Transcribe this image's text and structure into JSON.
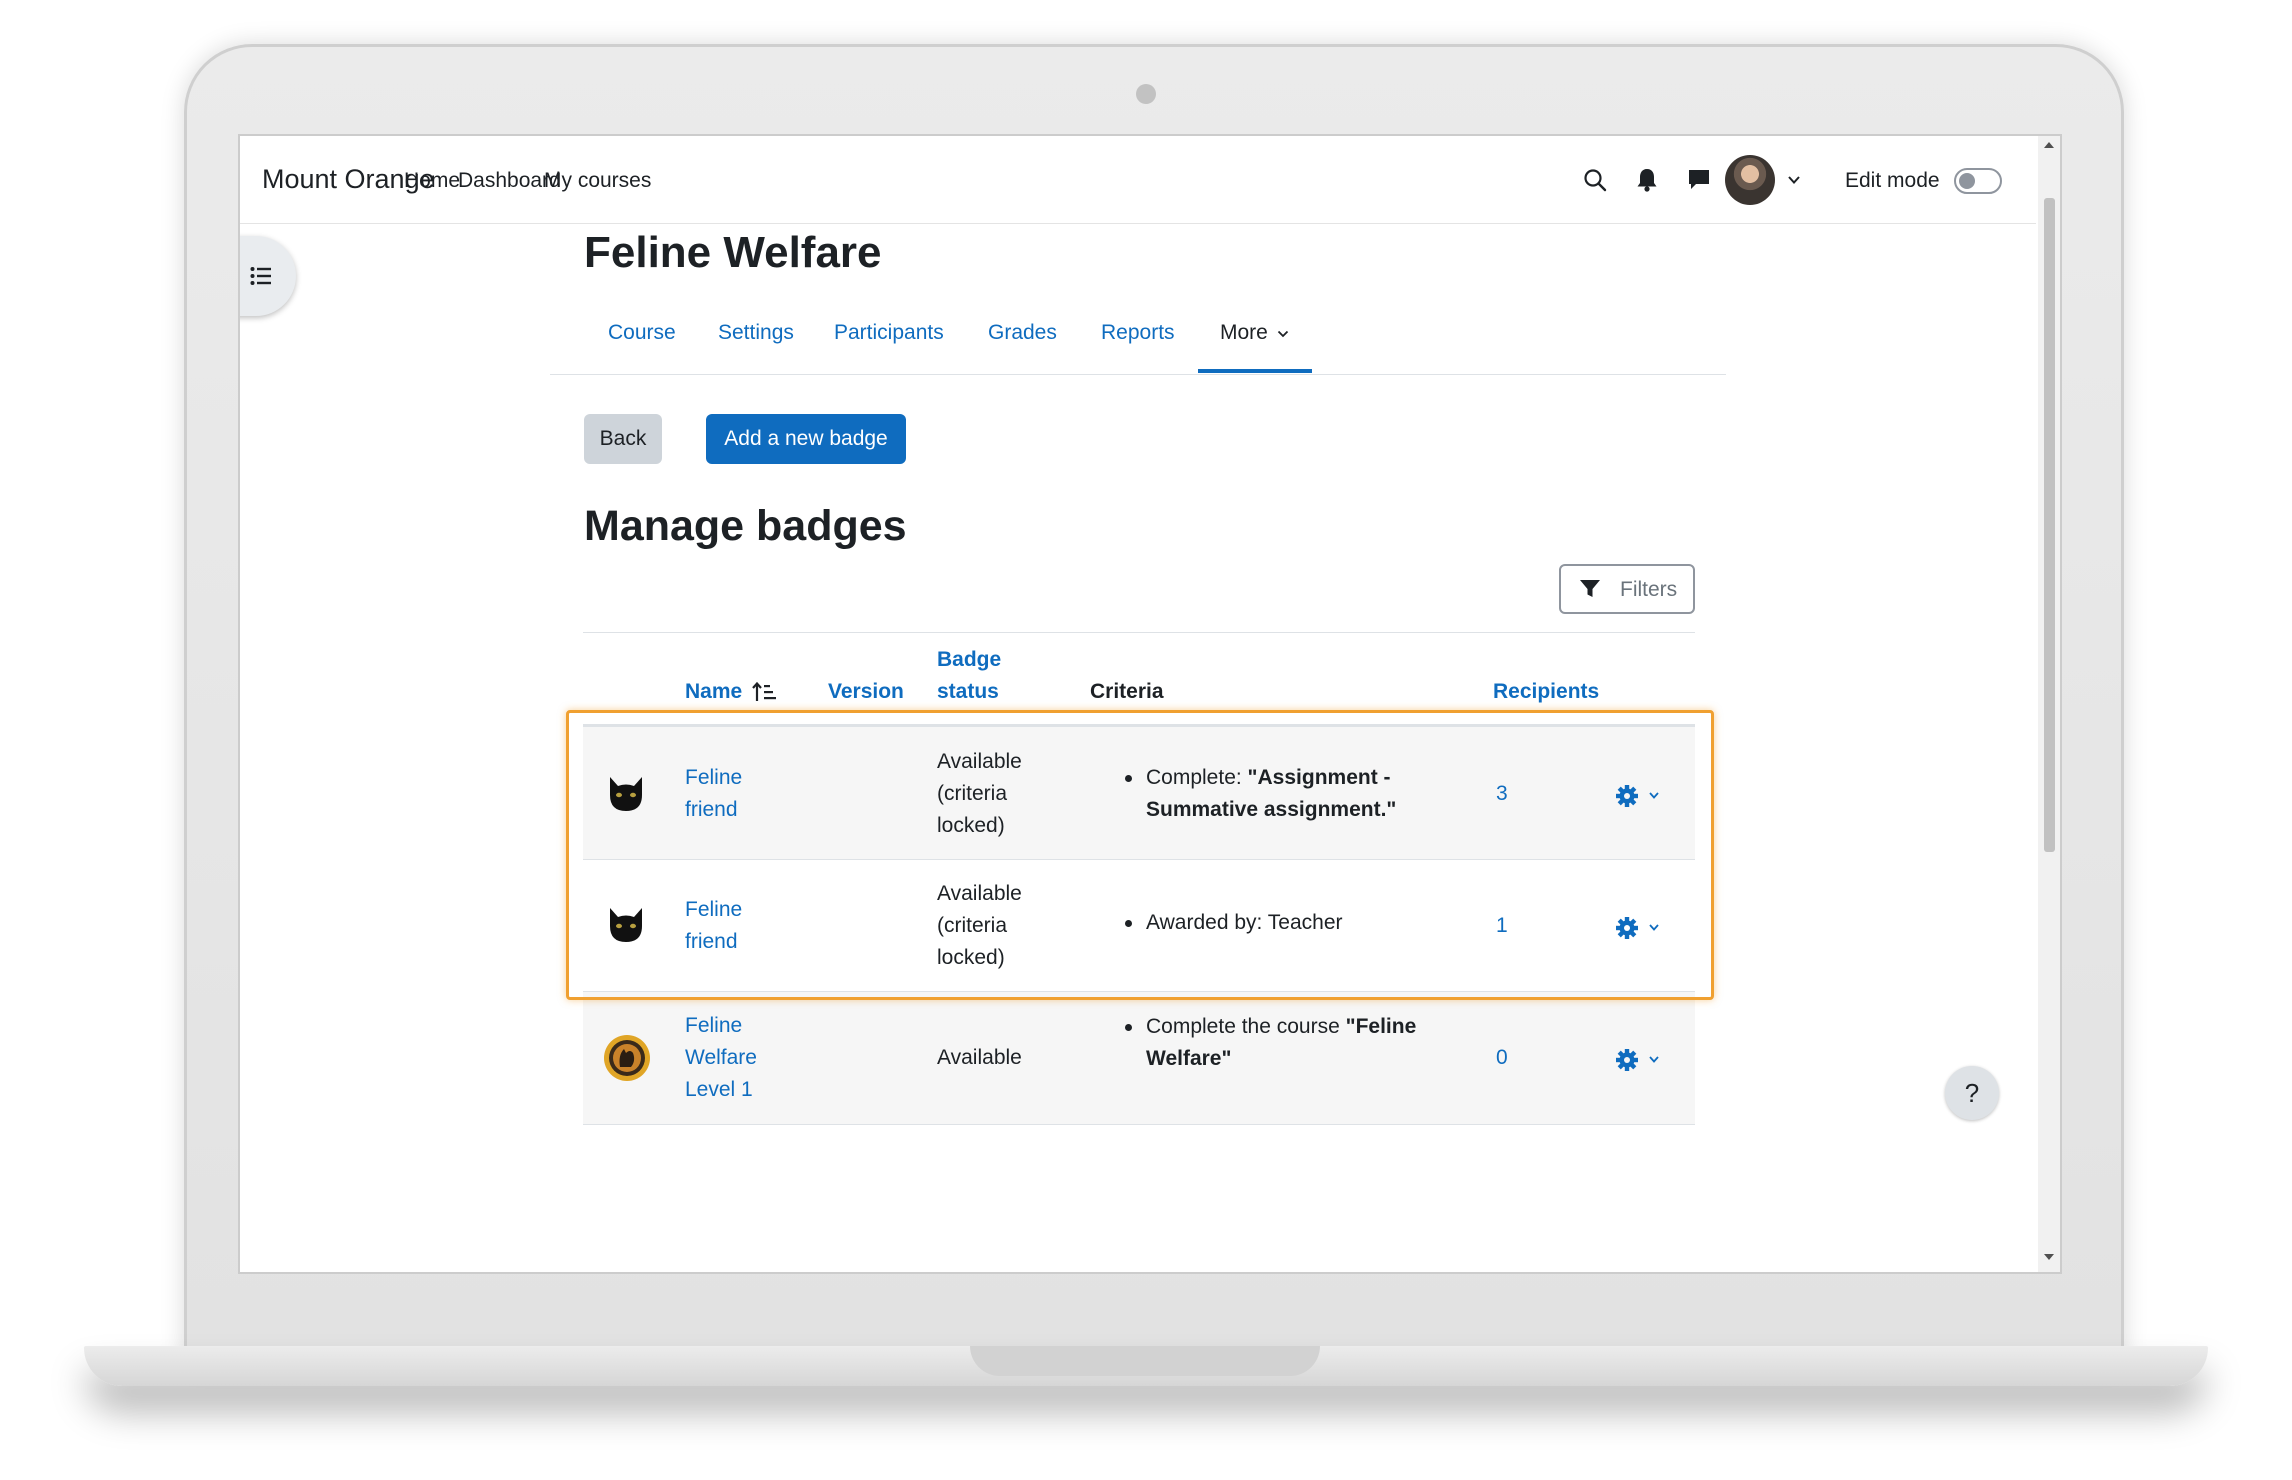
{
  "navbar": {
    "site_name": "Mount Orange",
    "links": [
      "Home",
      "Dashboard",
      "My courses"
    ],
    "edit_mode_label": "Edit mode",
    "edit_mode_on": false
  },
  "course": {
    "title": "Feline Welfare",
    "tabs": [
      "Course",
      "Settings",
      "Participants",
      "Grades",
      "Reports",
      "More"
    ],
    "active_tab": "More"
  },
  "actions": {
    "back_label": "Back",
    "add_badge_label": "Add a new badge"
  },
  "page": {
    "heading": "Manage badges",
    "filters_label": "Filters"
  },
  "table": {
    "headers": {
      "name": "Name",
      "version": "Version",
      "badge_status_line1": "Badge",
      "badge_status_line2": "status",
      "criteria": "Criteria",
      "recipients": "Recipients"
    },
    "rows": [
      {
        "name_line1": "Feline",
        "name_line2": "friend",
        "name_line3": "",
        "version": "",
        "status_line1": "Available",
        "status_line2": "(criteria",
        "status_line3": "locked)",
        "criteria_prefix": "Complete: ",
        "criteria_bold_line1": "\"Assignment -",
        "criteria_bold_line2": "Summative assignment.\"",
        "recipients": "3"
      },
      {
        "name_line1": "Feline",
        "name_line2": "friend",
        "name_line3": "",
        "version": "",
        "status_line1": "Available",
        "status_line2": "(criteria",
        "status_line3": "locked)",
        "criteria_text": "Awarded by: Teacher",
        "recipients": "1"
      },
      {
        "name_line1": "Feline",
        "name_line2": "Welfare",
        "name_line3": "Level 1",
        "version": "",
        "status_line1": "Available",
        "criteria_prefix": "Complete the course ",
        "criteria_bold_line1": "\"Feline",
        "criteria_bold_line2": "Welfare\"",
        "recipients": "0"
      }
    ]
  },
  "help": {
    "label": "?"
  },
  "colors": {
    "accent": "#0f6cbf",
    "highlight": "#f0a030",
    "text": "#1d2125"
  }
}
